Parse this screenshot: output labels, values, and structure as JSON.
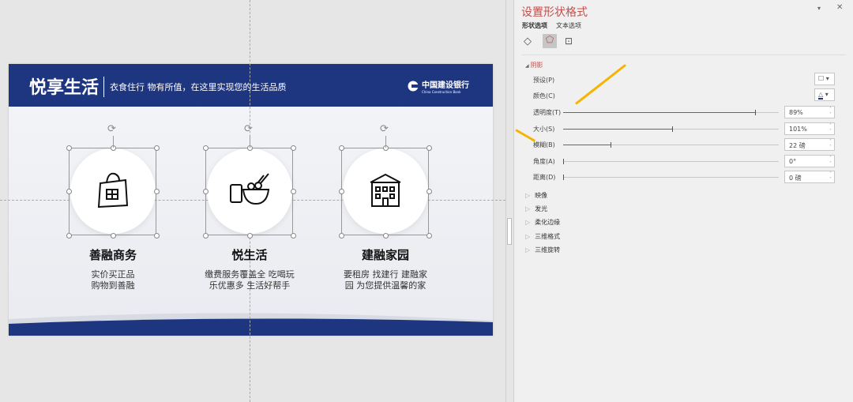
{
  "slide": {
    "title": "悦享生活",
    "subtitle": "衣食住行 物有所值，在这里实现您的生活品质",
    "logo": {
      "cn": "中国建设银行",
      "en": "China Construction Bank"
    },
    "cards": [
      {
        "title": "善融商务",
        "desc1": "实价买正品",
        "desc2": "购物到善融",
        "icon": "shopping-bag-icon"
      },
      {
        "title": "悦生活",
        "desc1": "缴费服务覆盖全 吃喝玩",
        "desc2": "乐优惠多 生活好帮手",
        "icon": "food-bowl-icon"
      },
      {
        "title": "建融家园",
        "desc1": "要租房 找建行 建融家",
        "desc2": "园 为您提供温馨的家",
        "icon": "building-icon"
      }
    ]
  },
  "panel": {
    "title": "设置形状格式",
    "tabs": [
      "形状选项",
      "文本选项"
    ],
    "section": "阴影",
    "preset_label": "预设(P)",
    "color_label": "颜色(C)",
    "rows": [
      {
        "label": "透明度(T)",
        "value": "89%",
        "fraction": 0.89
      },
      {
        "label": "大小(S)",
        "value": "101%",
        "fraction": 0.505
      },
      {
        "label": "模糊(B)",
        "value": "22 磅",
        "fraction": 0.22
      },
      {
        "label": "角度(A)",
        "value": "0°",
        "fraction": 0
      },
      {
        "label": "距离(D)",
        "value": "0 磅",
        "fraction": 0
      }
    ],
    "collapsed": [
      "映像",
      "发光",
      "柔化边缘",
      "三维格式",
      "三维旋转"
    ]
  },
  "colors": {
    "brand": "#1e3580",
    "accent": "#c0504d",
    "annotation": "#f5b400"
  }
}
